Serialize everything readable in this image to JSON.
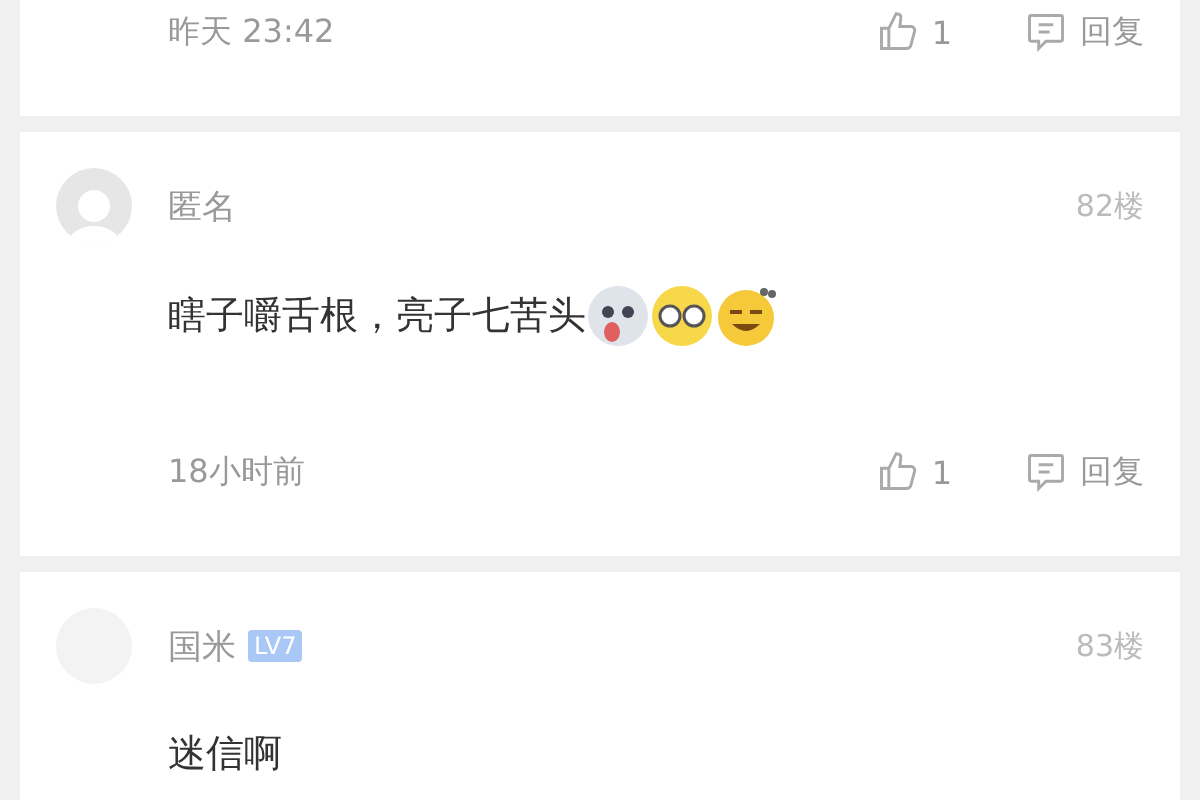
{
  "comments": [
    {
      "time": "昨天 23:42",
      "likes": "1",
      "reply": "回复"
    },
    {
      "avatar": {
        "kind": "silhouette"
      },
      "name": "匿名",
      "floor": "82楼",
      "text": "瞎子嚼舌根，亮子七苦头",
      "emojis": [
        {
          "kind": "husky"
        },
        {
          "kind": "glasses"
        },
        {
          "kind": "confused"
        }
      ],
      "time": "18小时前",
      "likes": "1",
      "reply": "回复"
    },
    {
      "avatar": {
        "kind": "plain"
      },
      "name": "国米",
      "badge": "LV7",
      "floor": "83楼",
      "text": "迷信啊"
    }
  ]
}
